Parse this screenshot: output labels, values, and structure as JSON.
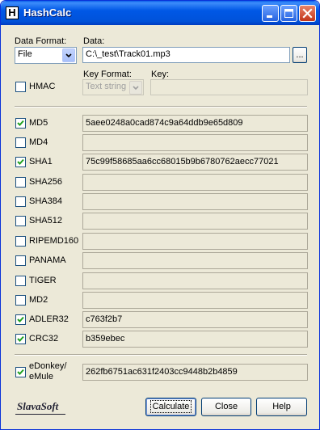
{
  "window": {
    "title": "HashCalc",
    "icon_letter": "H"
  },
  "data_format": {
    "label": "Data Format:",
    "value": "File"
  },
  "data": {
    "label": "Data:",
    "value": "C:\\_test\\Track01.mp3",
    "browse_label": "..."
  },
  "hmac": {
    "label": "HMAC",
    "checked": false
  },
  "key_format": {
    "label": "Key Format:",
    "value": "Text string",
    "disabled": true
  },
  "key": {
    "label": "Key:",
    "value": "",
    "disabled": true
  },
  "hashes": [
    {
      "name": "MD5",
      "checked": true,
      "value": "5aee0248a0cad874c9a64ddb9e65d809"
    },
    {
      "name": "MD4",
      "checked": false,
      "value": ""
    },
    {
      "name": "SHA1",
      "checked": true,
      "value": "75c99f58685aa6cc68015b9b6780762aecc77021"
    },
    {
      "name": "SHA256",
      "checked": false,
      "value": ""
    },
    {
      "name": "SHA384",
      "checked": false,
      "value": ""
    },
    {
      "name": "SHA512",
      "checked": false,
      "value": ""
    },
    {
      "name": "RIPEMD160",
      "checked": false,
      "value": ""
    },
    {
      "name": "PANAMA",
      "checked": false,
      "value": ""
    },
    {
      "name": "TIGER",
      "checked": false,
      "value": ""
    },
    {
      "name": "MD2",
      "checked": false,
      "value": ""
    },
    {
      "name": "ADLER32",
      "checked": true,
      "value": "c763f2b7"
    },
    {
      "name": "CRC32",
      "checked": true,
      "value": "b359ebec"
    }
  ],
  "edonkey": {
    "label_line1": "eDonkey/",
    "label_line2": "eMule",
    "checked": true,
    "value": "262fb6751ac631f2403cc9448b2b4859"
  },
  "footer": {
    "logo": "SlavaSoft",
    "calculate": "Calculate",
    "close": "Close",
    "help": "Help"
  },
  "colors": {
    "title_bar": "#0054e3",
    "face": "#ece9d8",
    "field_border": "#7f9db9"
  }
}
